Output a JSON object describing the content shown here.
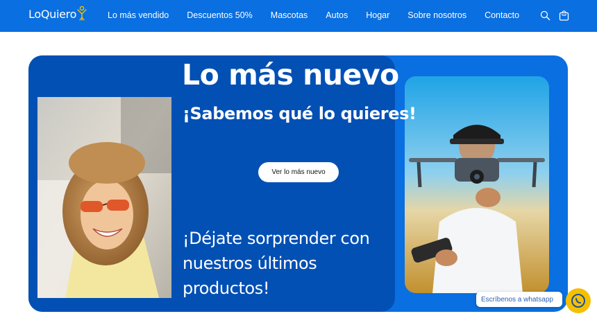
{
  "header": {
    "logo_text": "LoQuiero",
    "nav": [
      {
        "label": "Lo más vendido"
      },
      {
        "label": "Descuentos 50%"
      },
      {
        "label": "Mascotas"
      },
      {
        "label": "Autos"
      },
      {
        "label": "Hogar"
      },
      {
        "label": "Sobre nosotros"
      },
      {
        "label": "Contacto"
      }
    ],
    "icons": {
      "search": "search-icon",
      "cart": "cart-icon"
    }
  },
  "hero": {
    "title": "Lo más nuevo",
    "subtitle": "¡Sabemos qué lo quieres!",
    "cta_label": "Ver lo más nuevo",
    "body": "¡Déjate sorprender con nuestros últimos productos!"
  },
  "whatsapp": {
    "label": "Escríbenos a whatsapp",
    "icon": "whatsapp-icon"
  },
  "colors": {
    "header_bg": "#0a6fe0",
    "hero_outer": "#0a6fe0",
    "hero_inner": "#0350b4",
    "cta_bg": "#ffffff",
    "whatsapp_btn": "#f5c000"
  }
}
